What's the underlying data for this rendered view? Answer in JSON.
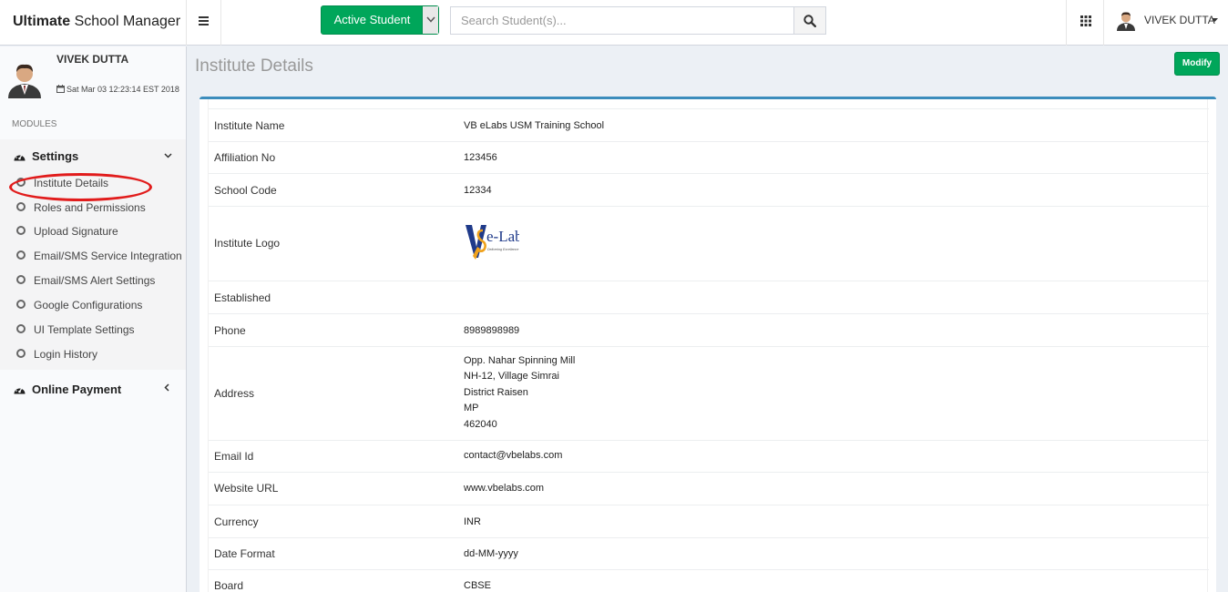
{
  "header": {
    "brand_bold": "Ultimate",
    "brand_rest": " School Manager",
    "menu_icon": "hamburger-icon",
    "active_student_label": "Active Student",
    "search_placeholder": "Search Student(s)...",
    "user_name": "VIVEK DUTTA"
  },
  "sidebar": {
    "user_name": "VIVEK DUTTA",
    "datetime": "Sat Mar 03 12:23:14 EST 2018",
    "modules_label": "MODULES",
    "settings_label": "Settings",
    "items": [
      {
        "label": "Institute Details"
      },
      {
        "label": "Roles and Permissions"
      },
      {
        "label": "Upload Signature"
      },
      {
        "label": "Email/SMS Service Integration"
      },
      {
        "label": "Email/SMS Alert Settings"
      },
      {
        "label": "Google Configurations"
      },
      {
        "label": "UI Template Settings"
      },
      {
        "label": "Login History"
      }
    ],
    "online_payment_label": "Online Payment"
  },
  "content": {
    "title": "Institute Details",
    "modify_label": "Modify",
    "fields": {
      "institute_name": {
        "label": "Institute Name",
        "value": "VB eLabs USM Training School"
      },
      "affiliation_no": {
        "label": "Affiliation No",
        "value": "123456"
      },
      "school_code": {
        "label": "School Code",
        "value": "12334"
      },
      "institute_logo": {
        "label": "Institute Logo",
        "logo_text": "e-Labs",
        "logo_tagline": "Delivering Excellence"
      },
      "established": {
        "label": "Established",
        "value": ""
      },
      "phone": {
        "label": "Phone",
        "value": "8989898989"
      },
      "address": {
        "label": "Address",
        "lines": [
          "Opp. Nahar Spinning Mill",
          "NH-12, Village Simrai",
          "District Raisen",
          "MP",
          "462040"
        ]
      },
      "email": {
        "label": "Email Id",
        "value": "contact@vbelabs.com"
      },
      "website": {
        "label": "Website URL",
        "value": "www.vbelabs.com"
      },
      "currency": {
        "label": "Currency",
        "value": "INR"
      },
      "date_format": {
        "label": "Date Format",
        "value": "dd-MM-yyyy"
      },
      "board": {
        "label": "Board",
        "value": "CBSE"
      }
    }
  },
  "colors": {
    "success": "#00a65a",
    "primary_border": "#3c8dbc",
    "highlight": "#e11c1c"
  }
}
